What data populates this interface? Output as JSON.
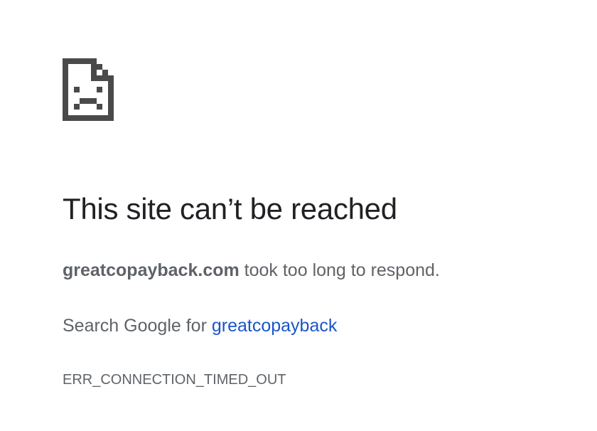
{
  "icon": "sad-page-icon",
  "title": "This site can’t be reached",
  "message": {
    "host": "greatcopayback.com",
    "text": " took too long to respond."
  },
  "suggestion": {
    "prefix": "Search Google for ",
    "link_text": "greatcopayback"
  },
  "error_code": "ERR_CONNECTION_TIMED_OUT",
  "colors": {
    "title": "#202124",
    "body": "#5f6368",
    "link": "#1a56c8",
    "icon": "#4a4a4a"
  }
}
